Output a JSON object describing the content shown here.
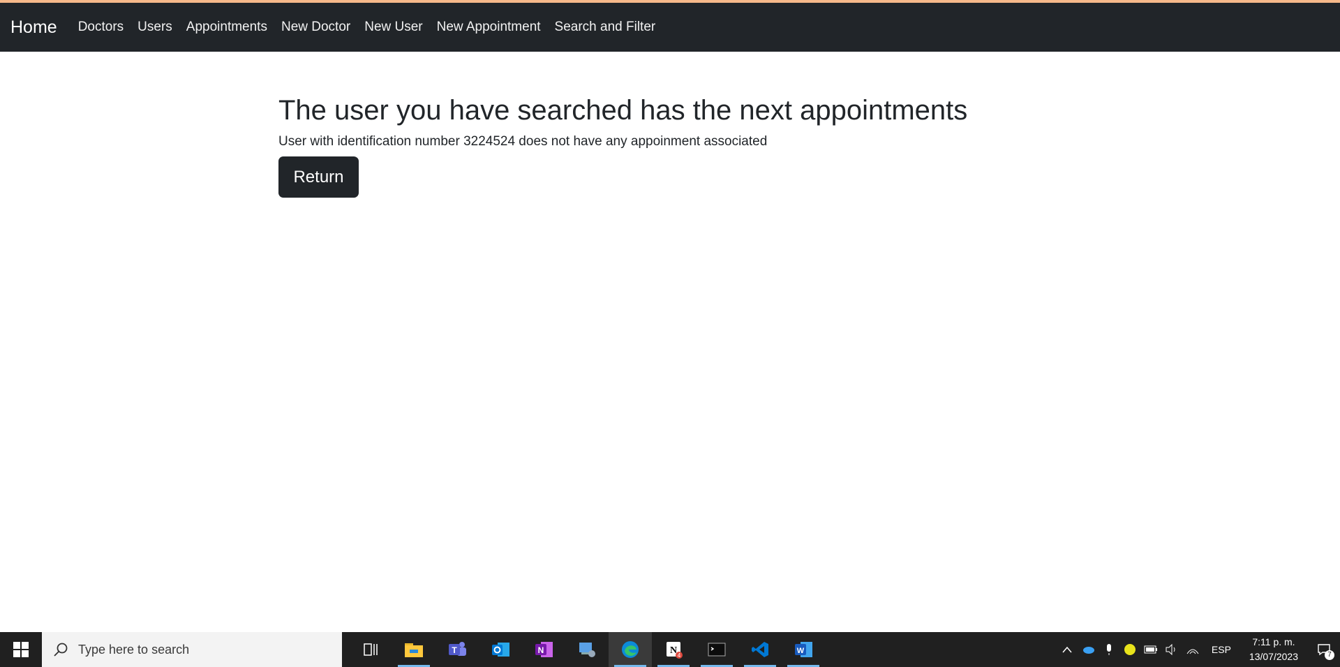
{
  "navbar": {
    "brand": "Home",
    "links": [
      {
        "label": "Doctors"
      },
      {
        "label": "Users"
      },
      {
        "label": "Appointments"
      },
      {
        "label": "New Doctor"
      },
      {
        "label": "New User"
      },
      {
        "label": "New Appointment"
      },
      {
        "label": "Search and Filter"
      }
    ]
  },
  "main": {
    "title": "The user you have searched has the next appointments",
    "message": "User with identification number 3224524 does not have any appoinment associated",
    "return_label": "Return"
  },
  "taskbar": {
    "search_placeholder": "Type here to search",
    "language": "ESP",
    "time": "7:11 p. m.",
    "date": "13/07/2023",
    "notification_count": "7",
    "icons": [
      "task-view-icon",
      "file-explorer-icon",
      "teams-icon",
      "outlook-icon",
      "onenote-icon",
      "remote-desktop-icon",
      "edge-icon",
      "notion-icon",
      "terminal-icon",
      "vscode-icon",
      "word-icon"
    ],
    "notion_badge": "4"
  },
  "colors": {
    "navbar_bg": "#212529",
    "accent_strip": "#f6b98a",
    "button_bg": "#212529",
    "taskbar_bg": "#202020"
  }
}
